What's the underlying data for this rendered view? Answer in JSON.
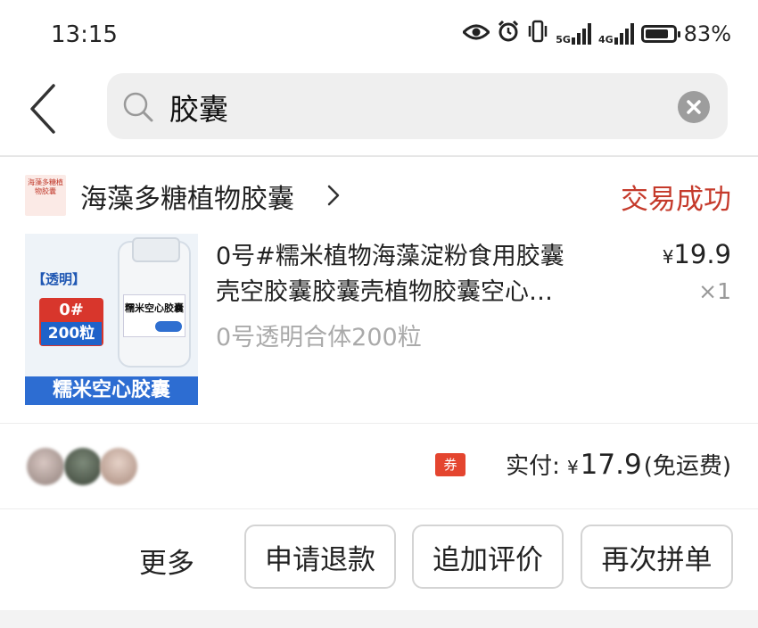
{
  "status_bar": {
    "time": "13:15",
    "network_5g": "5G",
    "network_4g": "4G",
    "battery_percent": "83%",
    "battery_level": 0.83
  },
  "search": {
    "query": "胶囊"
  },
  "shop": {
    "logo_text": "海藻多糖植物胶囊",
    "name": "海藻多糖植物胶囊",
    "order_status": "交易成功"
  },
  "product": {
    "image_tag": "【透明】",
    "image_size": "0#",
    "image_count": "200粒",
    "image_bottle_label": "糯米空心胶囊",
    "image_banner": "糯米空心胶囊",
    "title_line1": "0号#糯米植物海藻淀粉食用胶囊",
    "title_line2": "壳空胶囊胶囊壳植物胶囊空心…",
    "price_symbol": "¥",
    "price": "19.9",
    "quantity": "×1",
    "spec": "0号透明合体200粒"
  },
  "summary": {
    "coupon_label": "券",
    "paid_label": "实付:",
    "currency": "¥",
    "paid_amount": "17.9",
    "shipping_note": "(免运费)"
  },
  "actions": {
    "more": "更多",
    "refund": "申请退款",
    "add_review": "追加评价",
    "reorder": "再次拼单"
  },
  "colors": {
    "accent_red": "#c53a2b",
    "coupon_red": "#e4452f"
  }
}
